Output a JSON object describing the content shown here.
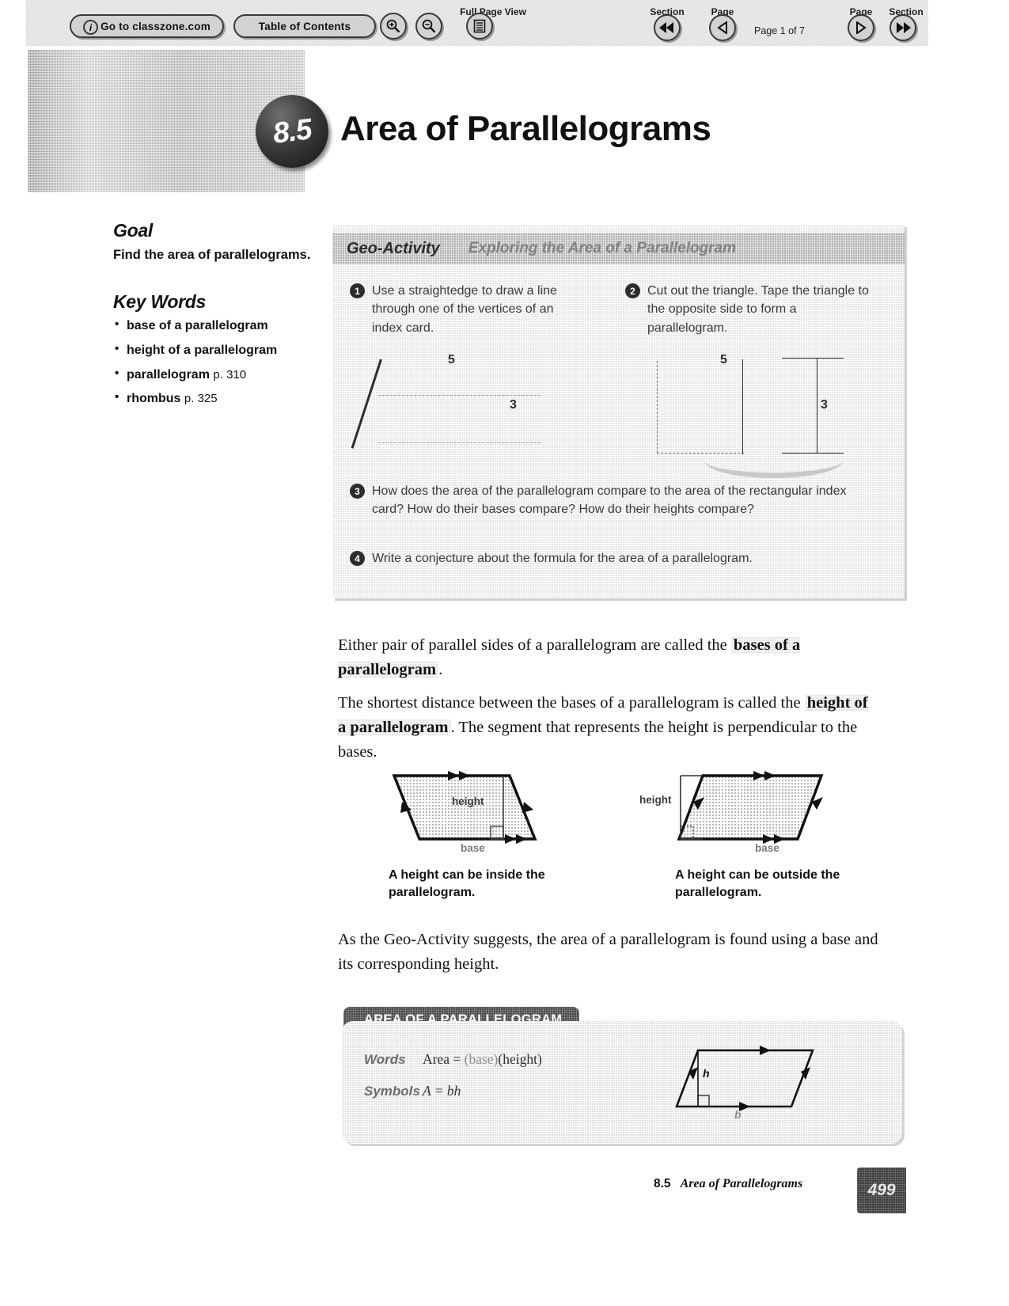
{
  "toolbar": {
    "classzone_button": "Go to classzone.com",
    "toc_button": "Table of Contents",
    "zoom_in_icon": "zoom-in-icon",
    "zoom_out_icon": "zoom-out-icon",
    "full_page_view_label": "Full Page View",
    "full_page_icon": "page-list-icon",
    "prev_section_label": "Section",
    "prev_page_label": "Page",
    "next_page_label": "Page",
    "next_section_label": "Section",
    "page_indicator": "Page 1 of 7",
    "info_icon": "info-icon"
  },
  "header": {
    "section_number": "8.5",
    "title": "Area of Parallelograms"
  },
  "sidebar": {
    "goal_heading": "Goal",
    "goal_text": "Find the area of parallelograms.",
    "keywords_heading": "Key Words",
    "keywords": [
      {
        "term": "base of a parallelogram",
        "page": ""
      },
      {
        "term": "height of a parallelogram",
        "page": ""
      },
      {
        "term": "parallelogram",
        "page": "p. 310"
      },
      {
        "term": "rhombus",
        "page": "p. 325"
      }
    ]
  },
  "geo_activity": {
    "label": "Geo-Activity",
    "subtitle": "Exploring the Area of a Parallelogram",
    "steps": [
      {
        "num": "1",
        "text": "Use a straightedge to draw a line through one of the vertices of an index card."
      },
      {
        "num": "2",
        "text": "Cut out the triangle. Tape the triangle to the opposite side to form a parallelogram."
      },
      {
        "num": "3",
        "text": "How does the area of the parallelogram compare to the area of the rectangular index card? How do their bases compare? How do their heights compare?"
      },
      {
        "num": "4",
        "text": "Write a conjecture about the formula for the area of a parallelogram."
      }
    ],
    "figure1": {
      "top_dim": "5",
      "side_dim": "3"
    },
    "figure2": {
      "top_dim": "5",
      "side_dim": "3"
    }
  },
  "body": {
    "para1_a": "Either pair of parallel sides of a parallelogram are called the ",
    "para1_term": "bases of a parallelogram",
    "para1_b": ".",
    "para2_a": "The shortest distance between the bases of a parallelogram is called the ",
    "para2_term": "height of a parallelogram",
    "para2_b": ". The segment that represents the height is perpendicular to the bases.",
    "para3": "As the Geo-Activity suggests, the area of a parallelogram is found using a base and its corresponding height."
  },
  "figures": {
    "left": {
      "height_label": "height",
      "base_label": "base",
      "caption": "A height can be inside the parallelogram."
    },
    "right": {
      "height_label": "height",
      "base_label": "base",
      "caption": "A height can be outside the parallelogram."
    }
  },
  "formula_box": {
    "title": "AREA OF A PARALLELOGRAM",
    "words_key": "Words",
    "words_value_pre": "Area = ",
    "words_value_base": "(base)",
    "words_value_height": "(height)",
    "symbols_key": "Symbols",
    "symbols_value": "A = bh",
    "diagram_height_label": "h",
    "diagram_base_label": "b"
  },
  "footer": {
    "section": "8.5",
    "title": "Area of Parallelograms",
    "page_number": "499"
  }
}
